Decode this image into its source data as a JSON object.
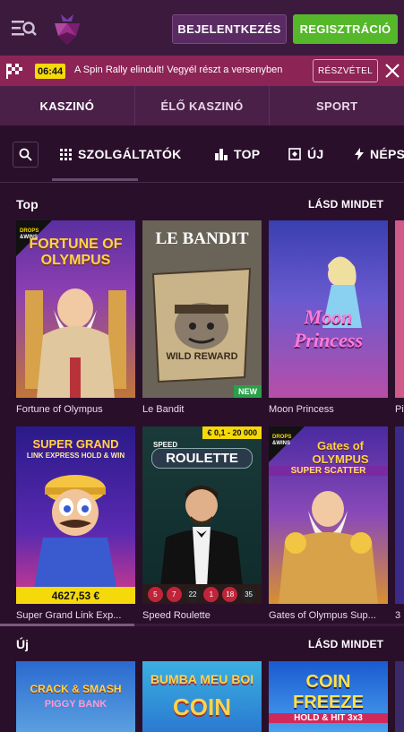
{
  "header": {
    "login_label": "BEJELENTKEZÉS",
    "register_label": "REGISZTRÁCIÓ",
    "menu_icon": "menu-search-icon",
    "logo_icon": "raspberry-logo"
  },
  "promo": {
    "timer": "06:44",
    "text": "A Spin Rally elindult! Vegyél részt a versenyben",
    "join_label": "RÉSZVÉTEL"
  },
  "main_nav": {
    "tabs": [
      {
        "label": "KASZINÓ"
      },
      {
        "label": "ÉLŐ KASZINÓ"
      },
      {
        "label": "SPORT"
      }
    ]
  },
  "sub_nav": {
    "tabs": [
      {
        "label": "SZOLGÁLTATÓK",
        "icon": "grid-icon"
      },
      {
        "label": "TOP",
        "icon": "podium-icon"
      },
      {
        "label": "ÚJ",
        "icon": "new-icon"
      },
      {
        "label": "NÉPS",
        "icon": "lightning-icon"
      }
    ]
  },
  "sections": [
    {
      "title": "Top",
      "see_all": "LÁSD MINDET",
      "rows": [
        [
          {
            "name": "Fortune of Olympus",
            "art_title": "FORTUNE OF OLYMPUS",
            "badge": "DROPS & WINS"
          },
          {
            "name": "Le Bandit",
            "art_title": "LE BANDIT",
            "art_sub": "WILD REWARD",
            "new_badge": "NEW"
          },
          {
            "name": "Moon Princess",
            "art_title": "Moon Princess"
          },
          {
            "name": "Pi"
          }
        ],
        [
          {
            "name": "Super Grand Link Exp...",
            "art_title": "SUPER GRAND",
            "art_sub": "LINK EXPRESS HOLD & WIN",
            "jackpot": "4627,53 €"
          },
          {
            "name": "Speed Roulette",
            "art_title": "ROULETTE",
            "art_pre": "SPEED",
            "bet": "€ 0,1 - 20 000",
            "numbers": [
              "5",
              "7",
              "22",
              "1",
              "18",
              "35"
            ]
          },
          {
            "name": "Gates of Olympus Sup...",
            "art_title": "Gates of OLYMPUS",
            "art_sub": "SUPER SCATTER",
            "badge": "DROPS & WINS"
          },
          {
            "name": "3"
          }
        ]
      ]
    },
    {
      "title": "Új",
      "see_all": "LÁSD MINDET",
      "rows": [
        [
          {
            "art_title": "CRACK & SMASH",
            "art_sub": "PIGGY BANK"
          },
          {
            "art_title": "BUMBA MEU BOI",
            "art_sub": "COIN"
          },
          {
            "art_title": "COIN FREEZE",
            "art_sub": "HOLD & HIT 3x3"
          },
          {}
        ]
      ]
    }
  ],
  "colors": {
    "background": "#2a0f2b",
    "header": "#3b1a3e",
    "promo": "#8c2456",
    "register": "#54b82a",
    "accent_yellow": "#f5d90a"
  }
}
